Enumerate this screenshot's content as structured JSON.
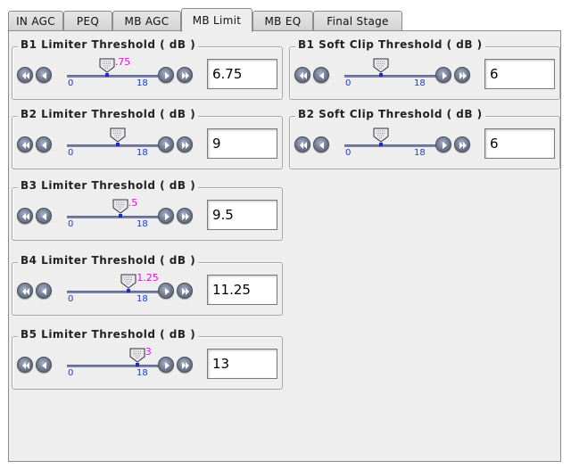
{
  "tabs": [
    {
      "label": "IN AGC",
      "active": false
    },
    {
      "label": "PEQ",
      "active": false
    },
    {
      "label": "MB AGC",
      "active": false
    },
    {
      "label": "MB Limit",
      "active": true
    },
    {
      "label": "MB EQ",
      "active": false
    },
    {
      "label": "Final Stage",
      "active": false
    }
  ],
  "controls": [
    {
      "title": "B1 Limiter Threshold ( dB )",
      "min": "0",
      "max": "18",
      "value": "6.75",
      "thumb_label": ".75",
      "level": 6.75
    },
    {
      "title": "B1 Soft Clip Threshold ( dB )",
      "min": "0",
      "max": "18",
      "value": "6",
      "thumb_label": "",
      "level": 6
    },
    {
      "title": "B2 Limiter Threshold ( dB )",
      "min": "0",
      "max": "18",
      "value": "9",
      "thumb_label": "",
      "level": 9
    },
    {
      "title": "B2 Soft Clip Threshold ( dB )",
      "min": "0",
      "max": "18",
      "value": "6",
      "thumb_label": "",
      "level": 6
    },
    {
      "title": "B3 Limiter Threshold ( dB )",
      "min": "0",
      "max": "18",
      "value": "9.5",
      "thumb_label": ".5",
      "level": 9.5
    },
    {
      "title": "B4 Limiter Threshold ( dB )",
      "min": "0",
      "max": "18",
      "value": "11.25",
      "thumb_label": "1.25",
      "level": 11.25
    },
    {
      "title": "B5 Limiter Threshold ( dB )",
      "min": "0",
      "max": "18",
      "value": "13",
      "thumb_label": "3",
      "level": 13
    }
  ],
  "colors": {
    "accent_label": "#ff00ff",
    "range_label": "#1a3ad0",
    "track": "#7b82a8"
  },
  "icons": {
    "fast_back": "double-left-arrow-icon",
    "back": "left-arrow-icon",
    "forward": "right-arrow-icon",
    "fast_forward": "double-right-arrow-icon",
    "thumb": "slider-thumb-icon"
  }
}
